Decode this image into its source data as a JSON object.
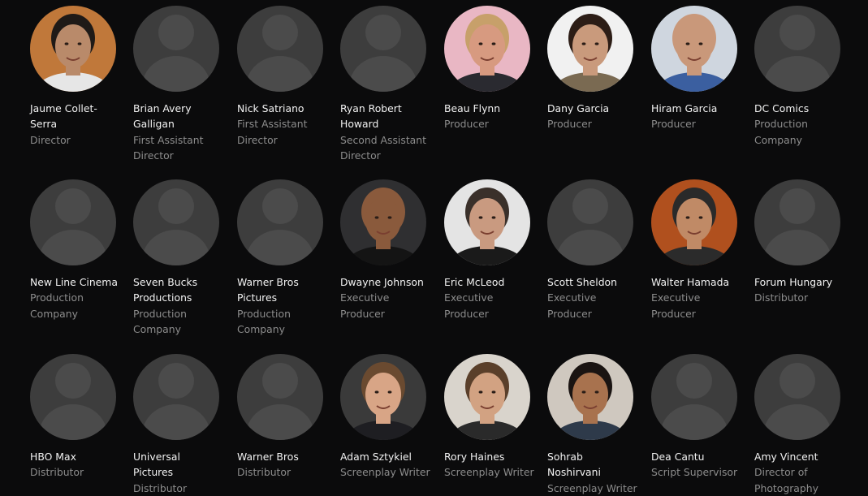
{
  "credits": [
    {
      "name": "Jaume Collet-\nSerra",
      "role": "Director",
      "photo": "jaume-collet-serra-photo",
      "has_photo": true,
      "bg": "#c0783a",
      "skin": "#b98a6a",
      "hair": "#1f1a17",
      "shirt": "#e6e6e6"
    },
    {
      "name": "Brian Avery\nGalligan",
      "role": "First Assistant\nDirector",
      "photo": "person-placeholder-icon",
      "has_photo": false
    },
    {
      "name": "Nick Satriano",
      "role": "First Assistant\nDirector",
      "photo": "person-placeholder-icon",
      "has_photo": false
    },
    {
      "name": "Ryan Robert\nHoward",
      "role": "Second Assistant\nDirector",
      "photo": "person-placeholder-icon",
      "has_photo": false
    },
    {
      "name": "Beau Flynn",
      "role": "Producer",
      "photo": "beau-flynn-photo",
      "has_photo": true,
      "bg": "#e9b7c4",
      "skin": "#d79a80",
      "hair": "#c7a06a",
      "shirt": "#2a2a30"
    },
    {
      "name": "Dany Garcia",
      "role": "Producer",
      "photo": "dany-garcia-photo",
      "has_photo": true,
      "bg": "#f1f1f1",
      "skin": "#c99a7c",
      "hair": "#2c1d16",
      "shirt": "#7a6a52"
    },
    {
      "name": "Hiram Garcia",
      "role": "Producer",
      "photo": "hiram-garcia-photo",
      "has_photo": true,
      "bg": "#cfd6df",
      "skin": "#c9987a",
      "hair": "#c9987a",
      "shirt": "#3b5fa0"
    },
    {
      "name": "DC Comics",
      "role": "Production\nCompany",
      "photo": "company-placeholder-icon",
      "has_photo": false
    },
    {
      "name": "New Line Cinema",
      "role": "Production\nCompany",
      "photo": "company-placeholder-icon",
      "has_photo": false
    },
    {
      "name": "Seven Bucks\nProductions",
      "role": "Production\nCompany",
      "photo": "company-placeholder-icon",
      "has_photo": false
    },
    {
      "name": "Warner Bros\nPictures",
      "role": "Production\nCompany",
      "photo": "company-placeholder-icon",
      "has_photo": false
    },
    {
      "name": "Dwayne Johnson",
      "role": "Executive\nProducer",
      "photo": "dwayne-johnson-photo",
      "has_photo": true,
      "bg": "#2f2f31",
      "skin": "#8a5a3c",
      "hair": "#8a5a3c",
      "shirt": "#141414"
    },
    {
      "name": "Eric McLeod",
      "role": "Executive\nProducer",
      "photo": "eric-mcleod-photo",
      "has_photo": true,
      "bg": "#e4e4e4",
      "skin": "#c99a80",
      "hair": "#3a302a",
      "shirt": "#1a1a1a"
    },
    {
      "name": "Scott Sheldon",
      "role": "Executive\nProducer",
      "photo": "person-placeholder-icon",
      "has_photo": false
    },
    {
      "name": "Walter Hamada",
      "role": "Executive\nProducer",
      "photo": "walter-hamada-photo",
      "has_photo": true,
      "bg": "#b0501e",
      "skin": "#c08a66",
      "hair": "#2a2a2a",
      "shirt": "#2b2b2b"
    },
    {
      "name": "Forum Hungary",
      "role": "Distributor",
      "photo": "company-placeholder-icon",
      "has_photo": false
    },
    {
      "name": "HBO Max",
      "role": "Distributor",
      "photo": "company-placeholder-icon",
      "has_photo": false
    },
    {
      "name": "Universal\nPictures",
      "role": "Distributor",
      "photo": "company-placeholder-icon",
      "has_photo": false
    },
    {
      "name": "Warner Bros",
      "role": "Distributor",
      "photo": "company-placeholder-icon",
      "has_photo": false
    },
    {
      "name": "Adam Sztykiel",
      "role": "Screenplay Writer",
      "photo": "adam-sztykiel-photo",
      "has_photo": true,
      "bg": "#3a3a3a",
      "skin": "#d8a586",
      "hair": "#6a4a30",
      "shirt": "#1e1e22"
    },
    {
      "name": "Rory Haines",
      "role": "Screenplay Writer",
      "photo": "rory-haines-photo",
      "has_photo": true,
      "bg": "#d9d4cc",
      "skin": "#d2a282",
      "hair": "#5a3f2a",
      "shirt": "#2a2a2a"
    },
    {
      "name": "Sohrab\nNoshirvani",
      "role": "Screenplay Writer",
      "photo": "sohrab-noshirvani-photo",
      "has_photo": true,
      "bg": "#cfc8bf",
      "skin": "#a8724e",
      "hair": "#1a1412",
      "shirt": "#2e3a4a"
    },
    {
      "name": "Dea Cantu",
      "role": "Script Supervisor",
      "photo": "person-placeholder-icon",
      "has_photo": false
    },
    {
      "name": "Amy Vincent",
      "role": "Director of\nPhotography",
      "photo": "person-placeholder-icon",
      "has_photo": false
    }
  ]
}
